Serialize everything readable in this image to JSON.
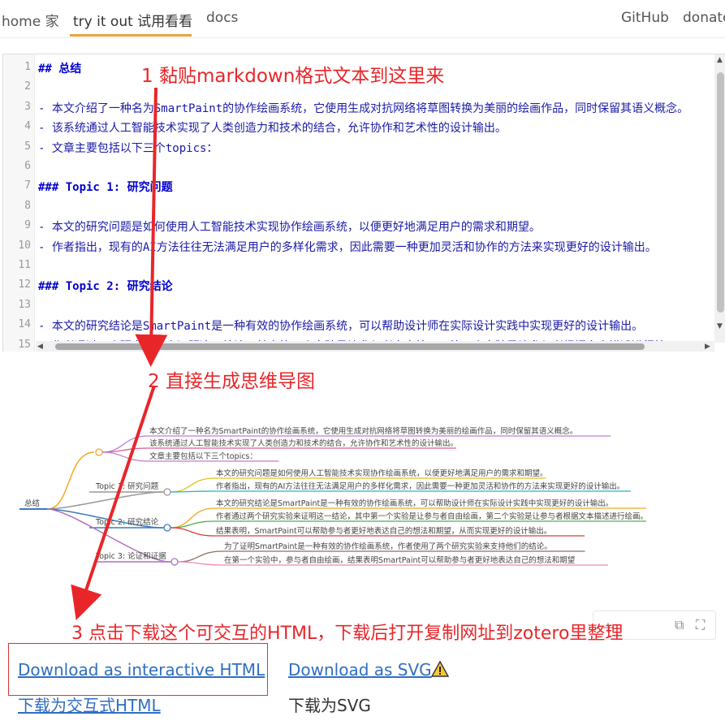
{
  "nav": {
    "home": "home 家",
    "try": "try it out 试用看看",
    "docs": "docs",
    "github": "GitHub",
    "donate": "donate"
  },
  "editor": {
    "line_numbers": [
      "1",
      "2",
      "3",
      "4",
      "5",
      "6",
      "7",
      "8",
      "9",
      "10",
      "11",
      "12",
      "13",
      "14",
      "15"
    ],
    "lines": [
      "## 总结",
      "",
      "- 本文介绍了一种名为SmartPaint的协作绘画系统，它使用生成对抗网络将草图转换为美丽的绘画作品，同时保留其语义概念。",
      "- 该系统通过人工智能技术实现了人类创造力和技术的结合，允许协作和艺术性的设计输出。",
      "- 文章主要包括以下三个topics：",
      "",
      "### Topic 1: 研究问题",
      "",
      "- 本文的研究问题是如何使用人工智能技术实现协作绘画系统，以便更好地满足用户的需求和期望。",
      "- 作者指出，现有的AI方法往往无法满足用户的多样化需求，因此需要一种更加灵活和协作的方法来实现更好的设计输出。",
      "",
      "### Topic 2: 研究结论",
      "",
      "- 本文的研究结论是SmartPaint是一种有效的协作绘画系统，可以帮助设计师在实际设计实践中实现更好的设计输出。",
      "- 作者通过两个研究实验来证明这一结论，其中第一个实验是让参与者自由绘画，第二个实验是让参与者根据文本描述进行绘画。"
    ]
  },
  "mindmap": {
    "root": "总结",
    "branches": [
      {
        "label": "",
        "color": "#f5a623",
        "leaves": [
          "本文介绍了一种名为SmartPaint的协作绘画系统，它使用生成对抗网络将草图转换为美丽的绘画作品，同时保留其语义概念。",
          "该系统通过人工智能技术实现了人类创造力和技术的结合，允许协作和艺术性的设计输出。",
          "文章主要包括以下三个topics："
        ],
        "leaf_colors": [
          "#c27ad8",
          "#e05c8a",
          "#c27ad8"
        ]
      },
      {
        "label": "Topic 1: 研究问题",
        "color": "#999999",
        "leaves": [
          "本文的研究问题是如何使用人工智能技术实现协作绘画系统，以便更好地满足用户的需求和期望。",
          "作者指出，现有的AI方法往往无法满足用户的多样化需求，因此需要一种更加灵活和协作的方法来实现更好的设计输出。"
        ],
        "leaf_colors": [
          "#e3c21c",
          "#2bb5c4"
        ]
      },
      {
        "label": "Topic 2: 研究结论",
        "color": "#3a7bbf",
        "leaves": [
          "本文的研究结论是SmartPaint是一种有效的协作绘画系统，可以帮助设计师在实际设计实践中实现更好的设计输出。",
          "作者通过两个研究实验来证明这一结论，其中第一个实验是让参与者自由绘画，第二个实验是让参与者根据文本描述进行绘画。",
          "结果表明，SmartPaint可以帮助参与者更好地表达自己的想法和期望，从而实现更好的设计输出。"
        ],
        "leaf_colors": [
          "#f5a623",
          "#4caf50",
          "#d33d3d"
        ]
      },
      {
        "label": "Topic 3: 论证和证据",
        "color": "#b06ec4",
        "leaves": [
          "为了证明SmartPaint是一种有效的协作绘画系统，作者使用了两个研究实验来支持他们的结论。",
          "在第一个实验中，参与者自由绘画，结果表明SmartPaint可以帮助参与者更好地表达自己的想法和期望"
        ],
        "leaf_colors": [
          "#8d6e63",
          "#e88ab8"
        ]
      }
    ]
  },
  "annotations": {
    "step1": "1 黏贴markdown格式文本到这里来",
    "step2": "2 直接生成思维导图",
    "step3": "3 点击下载这个可交互的HTML，下载后打开复制网址到zotero里整理",
    "color": "#e8262a"
  },
  "downloads": {
    "html": "Download as interactive HTML",
    "svg": "Download as SVG",
    "html_cn": "下载为交互式HTML",
    "svg_cn": "下载为SVG"
  },
  "toolbar_icons": [
    "zoom-in-icon",
    "fit-icon",
    "fullscreen-icon"
  ]
}
